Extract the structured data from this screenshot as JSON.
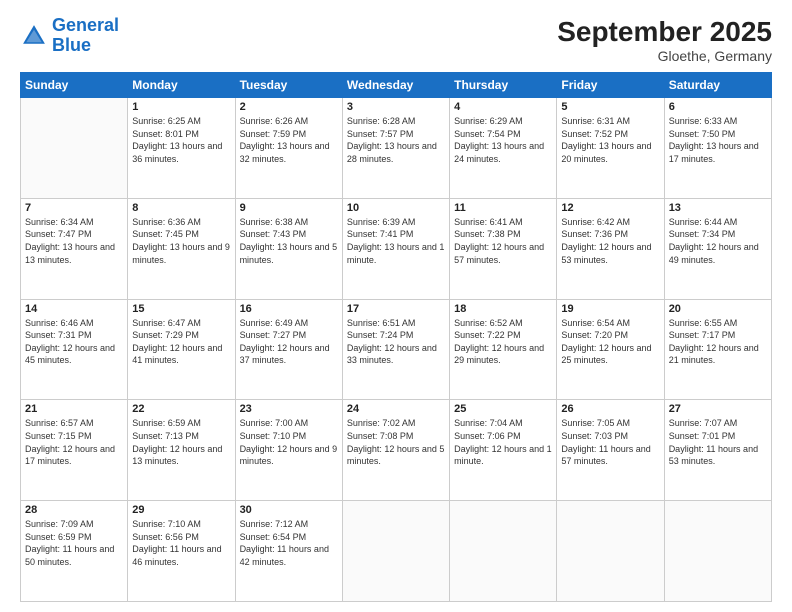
{
  "logo": {
    "line1": "General",
    "line2": "Blue"
  },
  "title": "September 2025",
  "subtitle": "Gloethe, Germany",
  "weekdays": [
    "Sunday",
    "Monday",
    "Tuesday",
    "Wednesday",
    "Thursday",
    "Friday",
    "Saturday"
  ],
  "days": [
    {
      "num": "",
      "sunrise": "",
      "sunset": "",
      "daylight": ""
    },
    {
      "num": "1",
      "sunrise": "Sunrise: 6:25 AM",
      "sunset": "Sunset: 8:01 PM",
      "daylight": "Daylight: 13 hours and 36 minutes."
    },
    {
      "num": "2",
      "sunrise": "Sunrise: 6:26 AM",
      "sunset": "Sunset: 7:59 PM",
      "daylight": "Daylight: 13 hours and 32 minutes."
    },
    {
      "num": "3",
      "sunrise": "Sunrise: 6:28 AM",
      "sunset": "Sunset: 7:57 PM",
      "daylight": "Daylight: 13 hours and 28 minutes."
    },
    {
      "num": "4",
      "sunrise": "Sunrise: 6:29 AM",
      "sunset": "Sunset: 7:54 PM",
      "daylight": "Daylight: 13 hours and 24 minutes."
    },
    {
      "num": "5",
      "sunrise": "Sunrise: 6:31 AM",
      "sunset": "Sunset: 7:52 PM",
      "daylight": "Daylight: 13 hours and 20 minutes."
    },
    {
      "num": "6",
      "sunrise": "Sunrise: 6:33 AM",
      "sunset": "Sunset: 7:50 PM",
      "daylight": "Daylight: 13 hours and 17 minutes."
    },
    {
      "num": "7",
      "sunrise": "Sunrise: 6:34 AM",
      "sunset": "Sunset: 7:47 PM",
      "daylight": "Daylight: 13 hours and 13 minutes."
    },
    {
      "num": "8",
      "sunrise": "Sunrise: 6:36 AM",
      "sunset": "Sunset: 7:45 PM",
      "daylight": "Daylight: 13 hours and 9 minutes."
    },
    {
      "num": "9",
      "sunrise": "Sunrise: 6:38 AM",
      "sunset": "Sunset: 7:43 PM",
      "daylight": "Daylight: 13 hours and 5 minutes."
    },
    {
      "num": "10",
      "sunrise": "Sunrise: 6:39 AM",
      "sunset": "Sunset: 7:41 PM",
      "daylight": "Daylight: 13 hours and 1 minute."
    },
    {
      "num": "11",
      "sunrise": "Sunrise: 6:41 AM",
      "sunset": "Sunset: 7:38 PM",
      "daylight": "Daylight: 12 hours and 57 minutes."
    },
    {
      "num": "12",
      "sunrise": "Sunrise: 6:42 AM",
      "sunset": "Sunset: 7:36 PM",
      "daylight": "Daylight: 12 hours and 53 minutes."
    },
    {
      "num": "13",
      "sunrise": "Sunrise: 6:44 AM",
      "sunset": "Sunset: 7:34 PM",
      "daylight": "Daylight: 12 hours and 49 minutes."
    },
    {
      "num": "14",
      "sunrise": "Sunrise: 6:46 AM",
      "sunset": "Sunset: 7:31 PM",
      "daylight": "Daylight: 12 hours and 45 minutes."
    },
    {
      "num": "15",
      "sunrise": "Sunrise: 6:47 AM",
      "sunset": "Sunset: 7:29 PM",
      "daylight": "Daylight: 12 hours and 41 minutes."
    },
    {
      "num": "16",
      "sunrise": "Sunrise: 6:49 AM",
      "sunset": "Sunset: 7:27 PM",
      "daylight": "Daylight: 12 hours and 37 minutes."
    },
    {
      "num": "17",
      "sunrise": "Sunrise: 6:51 AM",
      "sunset": "Sunset: 7:24 PM",
      "daylight": "Daylight: 12 hours and 33 minutes."
    },
    {
      "num": "18",
      "sunrise": "Sunrise: 6:52 AM",
      "sunset": "Sunset: 7:22 PM",
      "daylight": "Daylight: 12 hours and 29 minutes."
    },
    {
      "num": "19",
      "sunrise": "Sunrise: 6:54 AM",
      "sunset": "Sunset: 7:20 PM",
      "daylight": "Daylight: 12 hours and 25 minutes."
    },
    {
      "num": "20",
      "sunrise": "Sunrise: 6:55 AM",
      "sunset": "Sunset: 7:17 PM",
      "daylight": "Daylight: 12 hours and 21 minutes."
    },
    {
      "num": "21",
      "sunrise": "Sunrise: 6:57 AM",
      "sunset": "Sunset: 7:15 PM",
      "daylight": "Daylight: 12 hours and 17 minutes."
    },
    {
      "num": "22",
      "sunrise": "Sunrise: 6:59 AM",
      "sunset": "Sunset: 7:13 PM",
      "daylight": "Daylight: 12 hours and 13 minutes."
    },
    {
      "num": "23",
      "sunrise": "Sunrise: 7:00 AM",
      "sunset": "Sunset: 7:10 PM",
      "daylight": "Daylight: 12 hours and 9 minutes."
    },
    {
      "num": "24",
      "sunrise": "Sunrise: 7:02 AM",
      "sunset": "Sunset: 7:08 PM",
      "daylight": "Daylight: 12 hours and 5 minutes."
    },
    {
      "num": "25",
      "sunrise": "Sunrise: 7:04 AM",
      "sunset": "Sunset: 7:06 PM",
      "daylight": "Daylight: 12 hours and 1 minute."
    },
    {
      "num": "26",
      "sunrise": "Sunrise: 7:05 AM",
      "sunset": "Sunset: 7:03 PM",
      "daylight": "Daylight: 11 hours and 57 minutes."
    },
    {
      "num": "27",
      "sunrise": "Sunrise: 7:07 AM",
      "sunset": "Sunset: 7:01 PM",
      "daylight": "Daylight: 11 hours and 53 minutes."
    },
    {
      "num": "28",
      "sunrise": "Sunrise: 7:09 AM",
      "sunset": "Sunset: 6:59 PM",
      "daylight": "Daylight: 11 hours and 50 minutes."
    },
    {
      "num": "29",
      "sunrise": "Sunrise: 7:10 AM",
      "sunset": "Sunset: 6:56 PM",
      "daylight": "Daylight: 11 hours and 46 minutes."
    },
    {
      "num": "30",
      "sunrise": "Sunrise: 7:12 AM",
      "sunset": "Sunset: 6:54 PM",
      "daylight": "Daylight: 11 hours and 42 minutes."
    },
    {
      "num": "",
      "sunrise": "",
      "sunset": "",
      "daylight": ""
    },
    {
      "num": "",
      "sunrise": "",
      "sunset": "",
      "daylight": ""
    },
    {
      "num": "",
      "sunrise": "",
      "sunset": "",
      "daylight": ""
    },
    {
      "num": "",
      "sunrise": "",
      "sunset": "",
      "daylight": ""
    }
  ],
  "rows": [
    [
      0,
      1,
      2,
      3,
      4,
      5,
      6
    ],
    [
      7,
      8,
      9,
      10,
      11,
      12,
      13
    ],
    [
      14,
      15,
      16,
      17,
      18,
      19,
      20
    ],
    [
      21,
      22,
      23,
      24,
      25,
      26,
      27
    ],
    [
      28,
      29,
      30,
      31,
      32,
      33,
      34
    ]
  ]
}
